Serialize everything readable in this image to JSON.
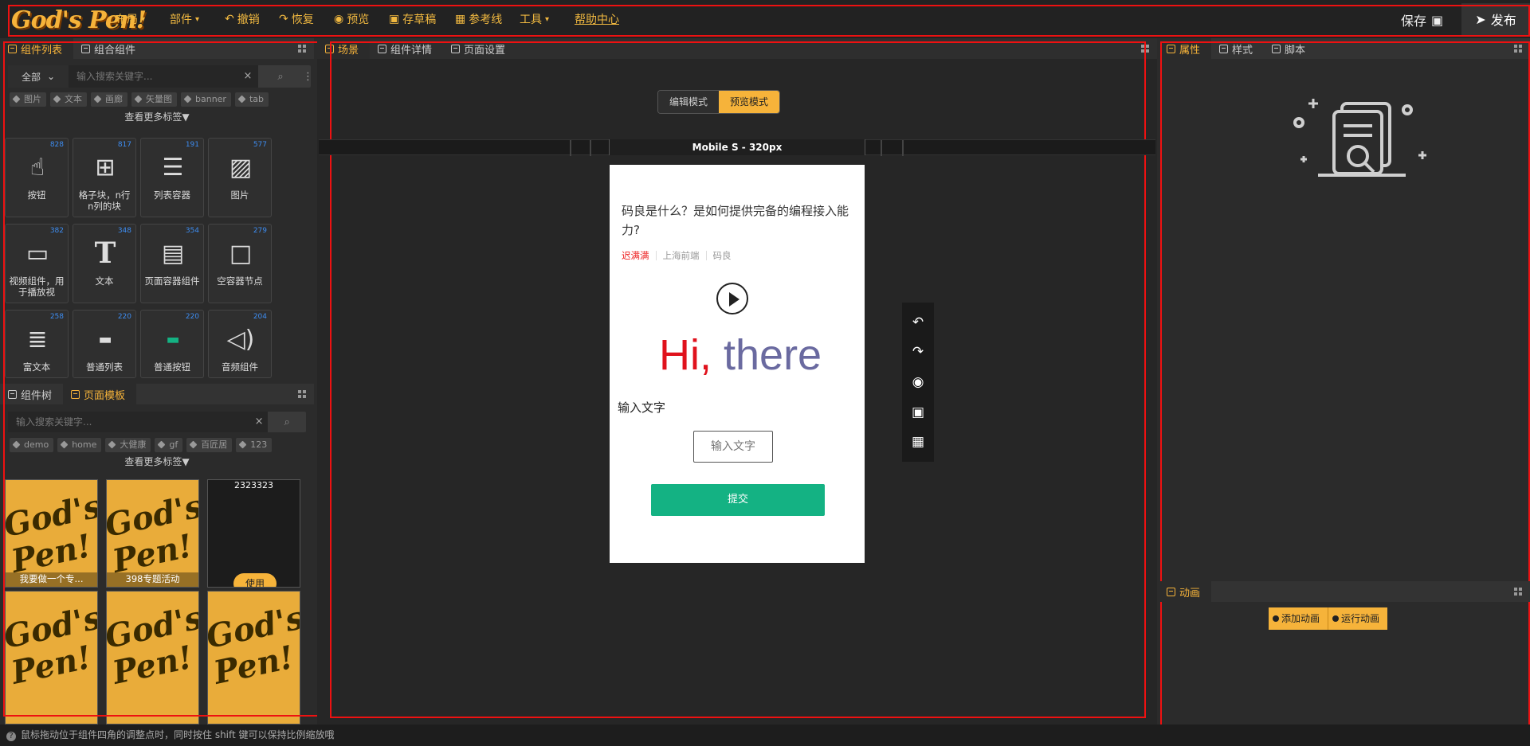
{
  "app": {
    "logo": "God's Pen!"
  },
  "toolbar": {
    "menus": [
      {
        "label": "布局",
        "icon": "chevron-down-icon"
      },
      {
        "label": "部件",
        "icon": "chevron-down-icon"
      },
      {
        "label": "撤销",
        "icon": "undo-icon"
      },
      {
        "label": "恢复",
        "icon": "redo-icon"
      },
      {
        "label": "预览",
        "icon": "eye-icon"
      },
      {
        "label": "存草稿",
        "icon": "save-icon"
      },
      {
        "label": "参考线",
        "icon": "grid-icon"
      },
      {
        "label": "工具",
        "icon": "chevron-down-icon"
      },
      {
        "label": "帮助中心",
        "icon": ""
      }
    ],
    "save_label": "保存",
    "publish_label": "发布"
  },
  "left_panel": {
    "tabs": [
      "组件列表",
      "组合组件"
    ],
    "filter_value": "全部",
    "search_placeholder": "输入搜索关键字...",
    "tags": [
      "图片",
      "文本",
      "画廊",
      "矢量图",
      "banner",
      "tab"
    ],
    "more_label": "查看更多标签▼",
    "components": [
      {
        "label": "按钮",
        "count": "828",
        "icon": "touch-icon"
      },
      {
        "label": "格子块，n行n列的块",
        "count": "817",
        "icon": "grid-icon"
      },
      {
        "label": "列表容器",
        "count": "191",
        "icon": "list-icon"
      },
      {
        "label": "图片",
        "count": "577",
        "icon": "image-icon"
      },
      {
        "label": "视频组件，用于播放视",
        "count": "382",
        "icon": "video-icon"
      },
      {
        "label": "文本",
        "count": "348",
        "icon": "text-icon"
      },
      {
        "label": "页面容器组件",
        "count": "354",
        "icon": "page-icon"
      },
      {
        "label": "空容器节点",
        "count": "279",
        "icon": "empty-box-icon"
      },
      {
        "label": "富文本",
        "count": "258",
        "icon": "richtext-icon"
      },
      {
        "label": "普通列表",
        "count": "220",
        "icon": "list-card-icon"
      },
      {
        "label": "普通按钮",
        "count": "220",
        "icon": "button-icon"
      },
      {
        "label": "音频组件",
        "count": "204",
        "icon": "audio-icon"
      }
    ]
  },
  "template_panel": {
    "tabs": [
      "组件树",
      "页面模板"
    ],
    "search_placeholder": "输入搜索关键字...",
    "tags": [
      "demo",
      "home",
      "大健康",
      "gf",
      "百匠居",
      "123"
    ],
    "more_label": "查看更多标签▼",
    "templates": [
      {
        "name": "我要做一个专..."
      },
      {
        "name": "398专题活动"
      },
      {
        "name": "2323323",
        "use_label": "使用"
      },
      {
        "name": ""
      },
      {
        "name": ""
      },
      {
        "name": ""
      }
    ]
  },
  "center": {
    "tabs": [
      "场景",
      "组件详情",
      "页面设置"
    ],
    "modes": {
      "edit": "编辑模式",
      "preview": "预览模式"
    },
    "device": "Mobile S - 320px",
    "phone": {
      "question": "码良是什么？是如何提供完备的编程接入能力?",
      "meta": [
        "迟满满",
        "上海前端",
        "码良"
      ],
      "hi_a": "Hi,",
      "hi_b": " there",
      "label": "输入文字",
      "input_placeholder": "输入文字",
      "submit": "提交"
    }
  },
  "right_panel": {
    "tabs": [
      "属性",
      "样式",
      "脚本"
    ],
    "anim_title": "动画",
    "add_anim": "添加动画",
    "run_anim": "运行动画"
  },
  "status": {
    "text": "鼠标拖动位于组件四角的调整点时，同时按住 shift 键可以保持比例缩放哦"
  },
  "colors": {
    "accent": "#f6b33a",
    "highlight": "#e11111",
    "submit": "#14b283"
  }
}
